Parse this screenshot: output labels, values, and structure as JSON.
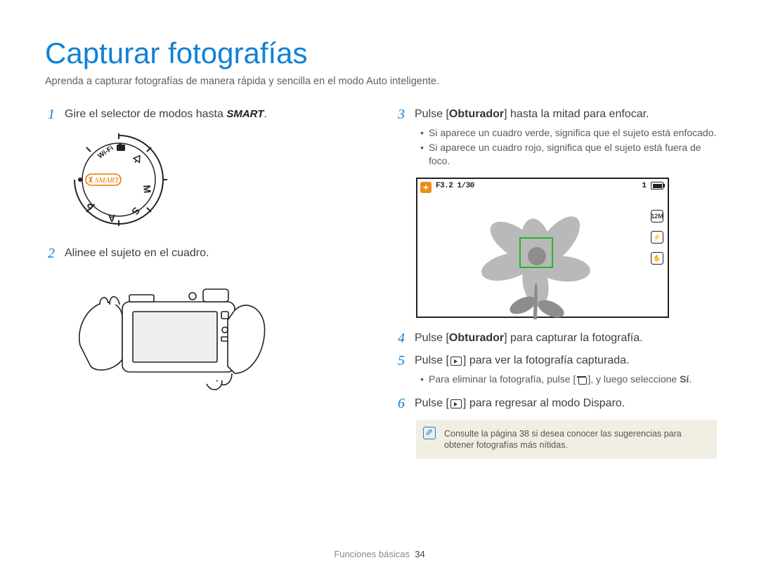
{
  "title": "Capturar fotografías",
  "intro": "Aprenda a capturar fotografías de manera rápida y sencilla en el modo Auto inteligente.",
  "left": {
    "step1_num": "1",
    "step1_a": "Gire el selector de modos hasta ",
    "step1_smart": "SMART",
    "step1_b": ".",
    "step2_num": "2",
    "step2": "Alinee el sujeto en el cuadro."
  },
  "right": {
    "step3_num": "3",
    "step3_a": "Pulse [",
    "step3_bold": "Obturador",
    "step3_b": "] hasta la mitad para enfocar.",
    "step3_bul1": "Si aparece un cuadro verde, significa que el sujeto está enfocado.",
    "step3_bul2": "Si aparece un cuadro rojo, significa que el sujeto está fuera de foco.",
    "lcd_exposure": "F3.2 1/30",
    "lcd_count": "1",
    "step4_num": "4",
    "step4_a": "Pulse [",
    "step4_bold": "Obturador",
    "step4_b": "] para capturar la fotografía.",
    "step5_num": "5",
    "step5_a": "Pulse [",
    "step5_b": "] para ver la fotografía capturada.",
    "step5_bul_a": "Para eliminar la fotografía, pulse [",
    "step5_bul_b": "], y luego seleccione ",
    "step5_bul_bold": "Sí",
    "step5_bul_c": ".",
    "step6_num": "6",
    "step6_a": "Pulse [",
    "step6_b": "] para regresar al modo Disparo.",
    "note": "Consulte la página 38 si desea conocer las sugerencias para obtener fotografías más nítidas."
  },
  "dial": {
    "wifi": "Wi-Fi",
    "smart": "SMART",
    "m": "M",
    "s": "S",
    "a": "A",
    "p": "P"
  },
  "footer_section": "Funciones básicas",
  "footer_page": "34"
}
